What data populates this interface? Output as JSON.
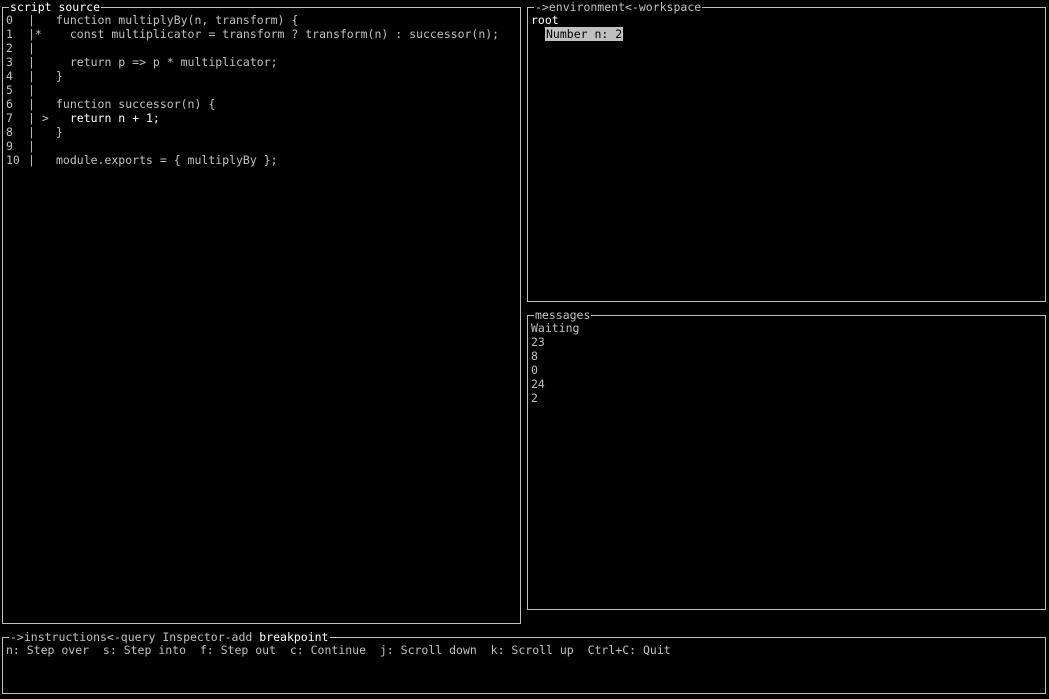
{
  "source": {
    "title": "script source",
    "lines": [
      {
        "num": "0",
        "marker": "|",
        "code": "function multiplyBy(n, transform) {"
      },
      {
        "num": "1",
        "marker": "|*",
        "code": "  const multiplicator = transform ? transform(n) : successor(n);"
      },
      {
        "num": "2",
        "marker": "|",
        "code": ""
      },
      {
        "num": "3",
        "marker": "|",
        "code": "  return p => p * multiplicator;"
      },
      {
        "num": "4",
        "marker": "|",
        "code": "}"
      },
      {
        "num": "5",
        "marker": "|",
        "code": ""
      },
      {
        "num": "6",
        "marker": "|",
        "code": "function successor(n) {"
      },
      {
        "num": "7",
        "marker": "| >",
        "code": "  return n + 1;"
      },
      {
        "num": "8",
        "marker": "|",
        "code": "}"
      },
      {
        "num": "9",
        "marker": "|",
        "code": ""
      },
      {
        "num": "10",
        "marker": "|",
        "code": "module.exports = { multiplyBy };"
      }
    ]
  },
  "environment": {
    "title": "->environment<-workspace",
    "root_label": "root",
    "selected_var": "Number n: 2"
  },
  "messages": {
    "title": "messages",
    "items": [
      "Waiting",
      "23",
      "8",
      "0",
      "24",
      "2"
    ]
  },
  "instructions": {
    "title_prefix": "->instructions<-query Inspector-add ",
    "title_highlight": "breakpoint",
    "text": "n: Step over  s: Step into  f: Step out  c: Continue  j: Scroll down  k: Scroll up  Ctrl+C: Quit"
  }
}
